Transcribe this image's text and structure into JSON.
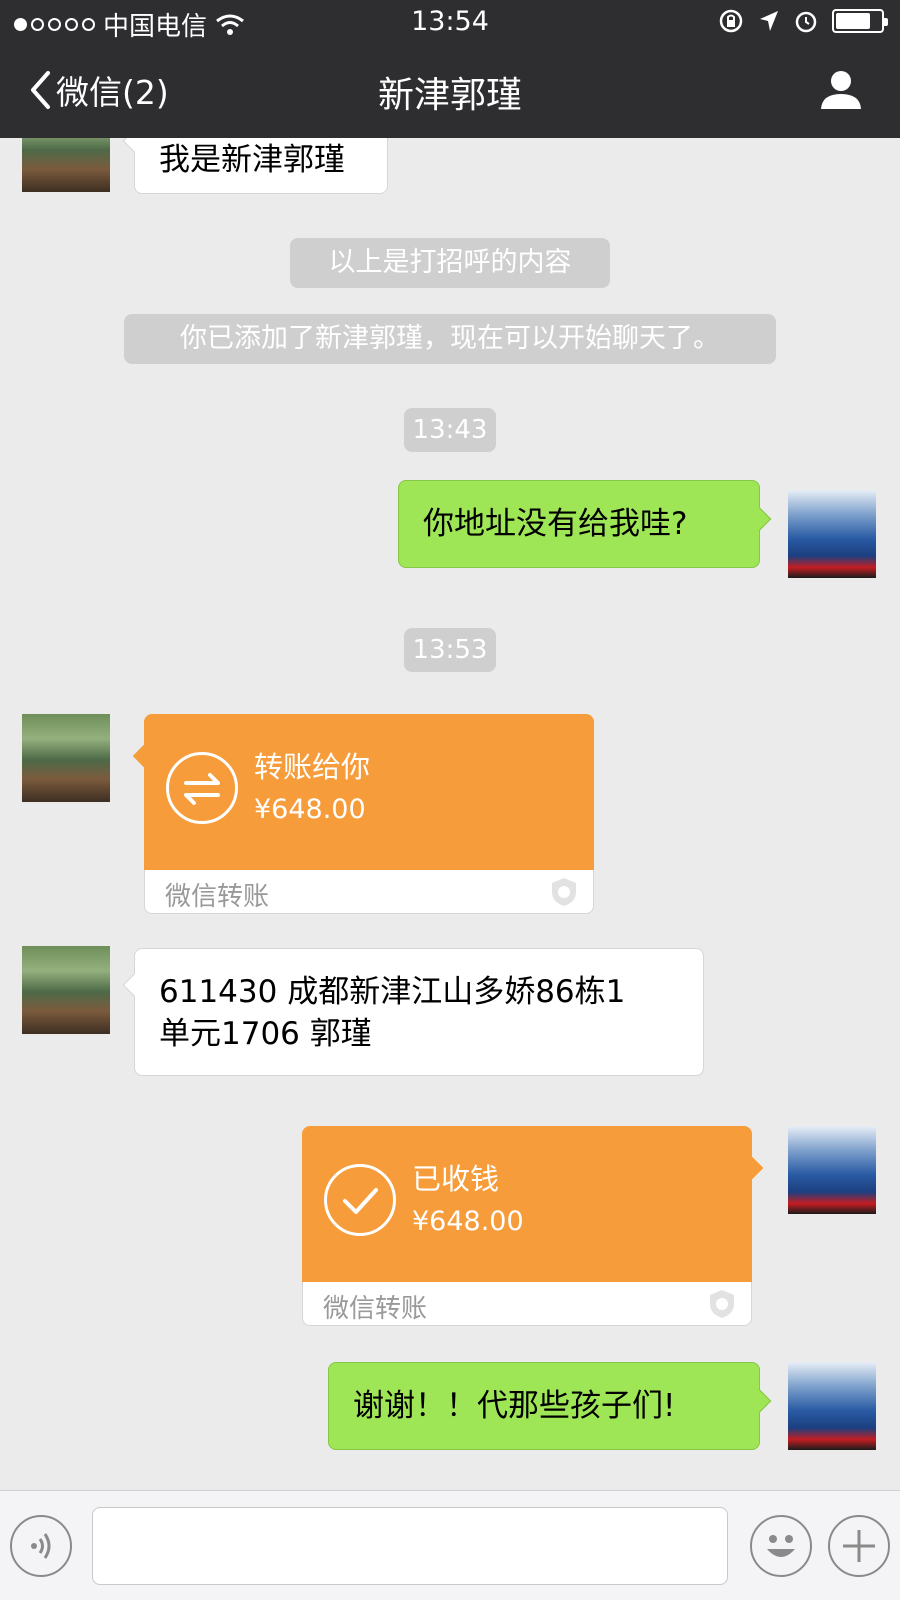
{
  "status_bar": {
    "carrier": "中国电信",
    "time": "13:54"
  },
  "nav": {
    "back_label": "微信(2)",
    "title": "新津郭瑾"
  },
  "messages": {
    "m1_text": "我是新津郭瑾",
    "sys1": "以上是打招呼的内容",
    "sys2": "你已添加了新津郭瑾，现在可以开始聊天了。",
    "time1": "13:43",
    "m2_text": "你地址没有给我哇?",
    "time2": "13:53",
    "transfer1": {
      "title": "转账给你",
      "amount": "¥648.00",
      "footer": "微信转账"
    },
    "m3_line1": "611430 成都新津江山多娇86栋1",
    "m3_line2": "单元1706 郭瑾",
    "transfer2": {
      "title": "已收钱",
      "amount": "¥648.00",
      "footer": "微信转账"
    },
    "m4_text": "谢谢！！代那些孩子们!"
  },
  "colors": {
    "nav_bg": "#2e2e31",
    "chat_bg": "#ebebeb",
    "green_bubble": "#9fe656",
    "transfer_orange": "#f79c3a"
  }
}
